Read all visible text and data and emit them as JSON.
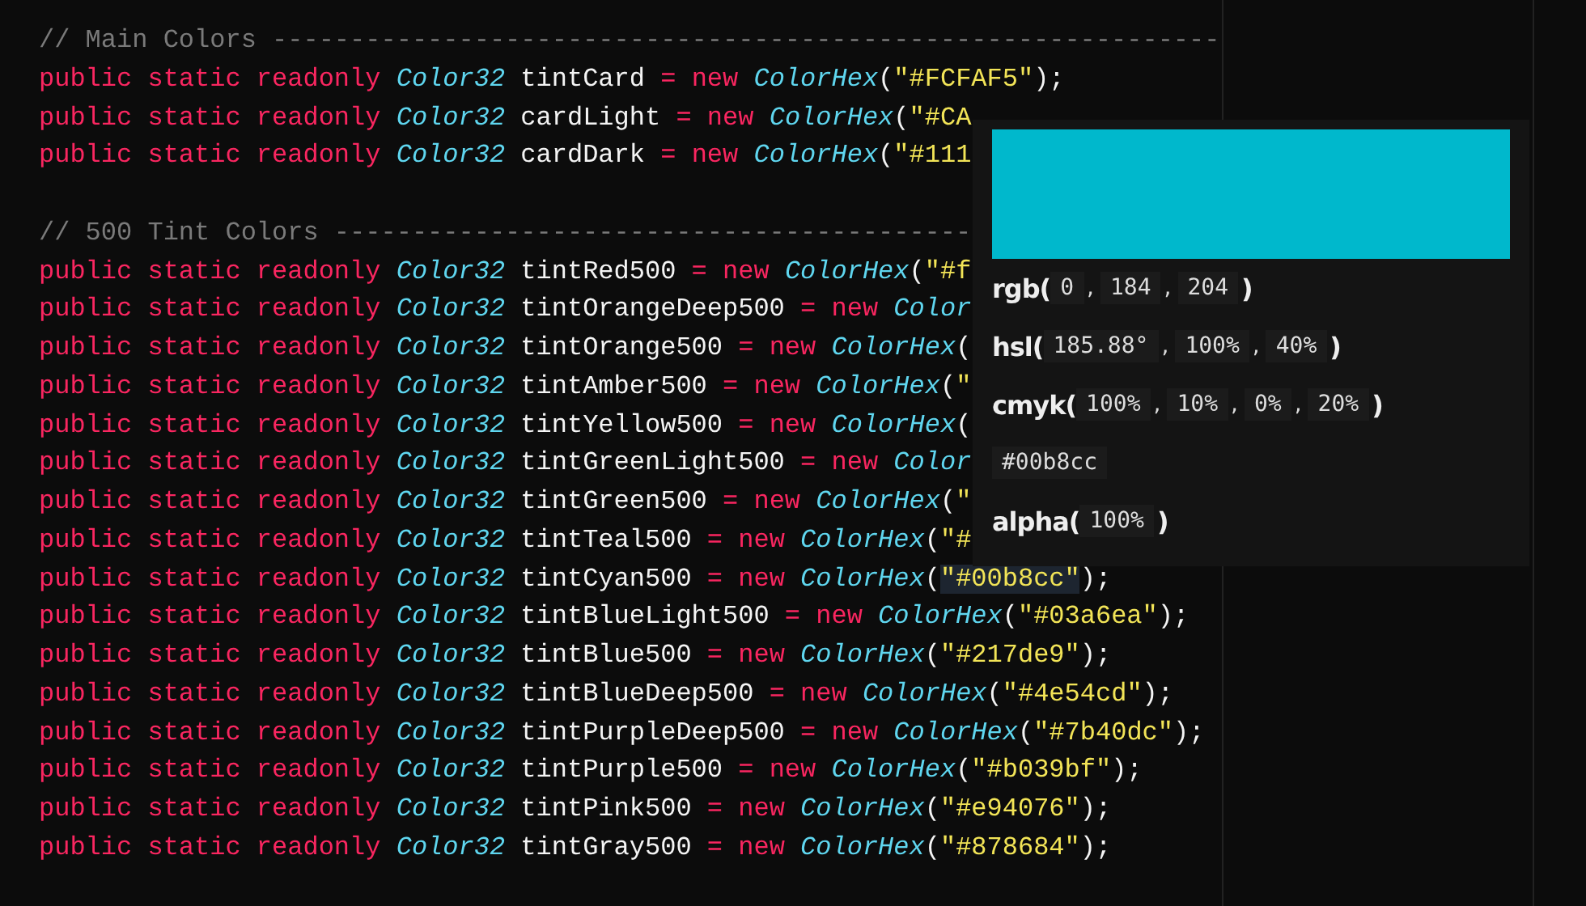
{
  "editor": {
    "lines": [
      {
        "kind": "comment",
        "text": "// Main Colors -------------------------------------------------------------"
      },
      {
        "kind": "decl",
        "modifiers": "public static readonly",
        "type": "Color32",
        "name": "tintCard",
        "op": "=",
        "new": "new",
        "ctor": "ColorHex",
        "open": "(",
        "string": "\"#FCFAF5\"",
        "close": ");"
      },
      {
        "kind": "decl",
        "modifiers": "public static readonly",
        "type": "Color32",
        "name": "cardLight",
        "op": "=",
        "new": "new",
        "ctor": "ColorHex",
        "open": "(",
        "string": "\"#CA"
      },
      {
        "kind": "decl",
        "modifiers": "public static readonly",
        "type": "Color32",
        "name": "cardDark",
        "op": "=",
        "new": "new",
        "ctor": "ColorHex",
        "open": "(",
        "string": "\"#111"
      },
      {
        "kind": "blank"
      },
      {
        "kind": "comment",
        "text": "// 500 Tint Colors -----------------------------------------"
      },
      {
        "kind": "decl",
        "modifiers": "public static readonly",
        "type": "Color32",
        "name": "tintRed500",
        "op": "=",
        "new": "new",
        "ctor": "ColorHex",
        "open": "(",
        "string": "\"#f"
      },
      {
        "kind": "decl",
        "modifiers": "public static readonly",
        "type": "Color32",
        "name": "tintOrangeDeep500",
        "op": "=",
        "new": "new",
        "ctor": "Color"
      },
      {
        "kind": "decl",
        "modifiers": "public static readonly",
        "type": "Color32",
        "name": "tintOrange500",
        "op": "=",
        "new": "new",
        "ctor": "ColorHex",
        "open": "("
      },
      {
        "kind": "decl",
        "modifiers": "public static readonly",
        "type": "Color32",
        "name": "tintAmber500",
        "op": "=",
        "new": "new",
        "ctor": "ColorHex",
        "open": "(",
        "string": "\""
      },
      {
        "kind": "decl",
        "modifiers": "public static readonly",
        "type": "Color32",
        "name": "tintYellow500",
        "op": "=",
        "new": "new",
        "ctor": "ColorHex",
        "open": "("
      },
      {
        "kind": "decl",
        "modifiers": "public static readonly",
        "type": "Color32",
        "name": "tintGreenLight500",
        "op": "=",
        "new": "new",
        "ctor": "Color"
      },
      {
        "kind": "decl",
        "modifiers": "public static readonly",
        "type": "Color32",
        "name": "tintGreen500",
        "op": "=",
        "new": "new",
        "ctor": "ColorHex",
        "open": "(",
        "string": "\""
      },
      {
        "kind": "decl",
        "modifiers": "public static readonly",
        "type": "Color32",
        "name": "tintTeal500",
        "op": "=",
        "new": "new",
        "ctor": "ColorHex",
        "open": "(",
        "string": "\"#"
      },
      {
        "kind": "decl",
        "modifiers": "public static readonly",
        "type": "Color32",
        "name": "tintCyan500",
        "op": "=",
        "new": "new",
        "ctor": "ColorHex",
        "open": "(",
        "string": "\"#00b8cc\"",
        "close": ");",
        "highlighted": true
      },
      {
        "kind": "decl",
        "modifiers": "public static readonly",
        "type": "Color32",
        "name": "tintBlueLight500",
        "op": "=",
        "new": "new",
        "ctor": "ColorHex",
        "open": "(",
        "string": "\"#03a6ea\"",
        "close": ");"
      },
      {
        "kind": "decl",
        "modifiers": "public static readonly",
        "type": "Color32",
        "name": "tintBlue500",
        "op": "=",
        "new": "new",
        "ctor": "ColorHex",
        "open": "(",
        "string": "\"#217de9\"",
        "close": ");"
      },
      {
        "kind": "decl",
        "modifiers": "public static readonly",
        "type": "Color32",
        "name": "tintBlueDeep500",
        "op": "=",
        "new": "new",
        "ctor": "ColorHex",
        "open": "(",
        "string": "\"#4e54cd\"",
        "close": ");"
      },
      {
        "kind": "decl",
        "modifiers": "public static readonly",
        "type": "Color32",
        "name": "tintPurpleDeep500",
        "op": "=",
        "new": "new",
        "ctor": "ColorHex",
        "open": "(",
        "string": "\"#7b40dc\"",
        "close": ");"
      },
      {
        "kind": "decl",
        "modifiers": "public static readonly",
        "type": "Color32",
        "name": "tintPurple500",
        "op": "=",
        "new": "new",
        "ctor": "ColorHex",
        "open": "(",
        "string": "\"#b039bf\"",
        "close": ");"
      },
      {
        "kind": "decl",
        "modifiers": "public static readonly",
        "type": "Color32",
        "name": "tintPink500",
        "op": "=",
        "new": "new",
        "ctor": "ColorHex",
        "open": "(",
        "string": "\"#e94076\"",
        "close": ");"
      },
      {
        "kind": "decl",
        "modifiers": "public static readonly",
        "type": "Color32",
        "name": "tintGray500",
        "op": "=",
        "new": "new",
        "ctor": "ColorHex",
        "open": "(",
        "string": "\"#878684\"",
        "close": ");"
      }
    ]
  },
  "color_popup": {
    "color": "#00b8cc",
    "rows": [
      {
        "kind": "function",
        "label": "rgb(",
        "values": [
          "0",
          "184",
          "204"
        ],
        "separator": ",",
        "close": ")"
      },
      {
        "kind": "function",
        "label": "hsl(",
        "values": [
          "185.88°",
          "100%",
          "40%"
        ],
        "separator": ",",
        "close": ")"
      },
      {
        "kind": "function",
        "label": "cmyk(",
        "values": [
          "100%",
          "10%",
          "0%",
          "20%"
        ],
        "separator": ",",
        "close": ")"
      },
      {
        "kind": "hex",
        "values": [
          "#00b8cc"
        ]
      },
      {
        "kind": "function",
        "label": "alpha(",
        "values": [
          "100%"
        ],
        "close": ")"
      }
    ]
  }
}
